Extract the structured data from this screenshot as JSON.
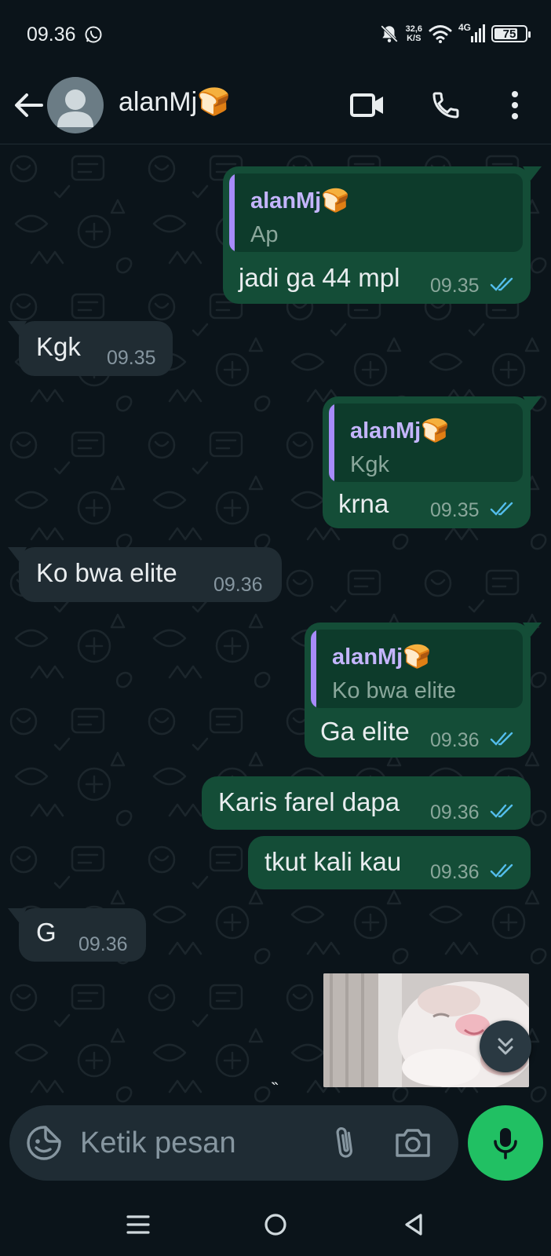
{
  "status_bar": {
    "time": "09.36",
    "net_speed_value": "32,6",
    "net_speed_unit": "K/S",
    "network": "4G",
    "battery": "75",
    "battery_level": 0.75
  },
  "header": {
    "contact_name": "alanMj🍞",
    "icons": [
      "back-arrow-icon",
      "video-call-icon",
      "voice-call-icon",
      "more-options-icon"
    ]
  },
  "messages": [
    {
      "direction": "outgoing",
      "quote_author": "alanMj🍞",
      "quote_text": "Ap",
      "text": "jadi ga 44 mpl",
      "time": "09.35",
      "status": "read"
    },
    {
      "direction": "incoming",
      "text": "Kgk",
      "time": "09.35"
    },
    {
      "direction": "outgoing",
      "quote_author": "alanMj🍞",
      "quote_text": "Kgk",
      "text": "krna",
      "time": "09.35",
      "status": "read"
    },
    {
      "direction": "incoming",
      "text": "Ko bwa elite",
      "time": "09.36"
    },
    {
      "direction": "outgoing",
      "quote_author": "alanMj🍞",
      "quote_text": "Ko bwa elite",
      "text": "Ga elite",
      "time": "09.36",
      "status": "read"
    },
    {
      "direction": "outgoing",
      "text": "Karis farel dapa",
      "time": "09.36",
      "status": "read"
    },
    {
      "direction": "outgoing",
      "text": "tkut kali kau",
      "time": "09.36",
      "status": "read"
    },
    {
      "direction": "incoming",
      "text": "G",
      "time": "09.36"
    }
  ],
  "sticker": {
    "kind": "cat-sticker-image"
  },
  "typing_indicator": "̏",
  "composer": {
    "placeholder": "Ketik pesan",
    "value": ""
  },
  "colors": {
    "background": "#0b141a",
    "outgoing_bubble": "#144d37",
    "incoming_bubble": "#202c33",
    "read_tick": "#53bdeb",
    "quote_author": "#c4b5fd",
    "mic_button": "#21c063"
  }
}
